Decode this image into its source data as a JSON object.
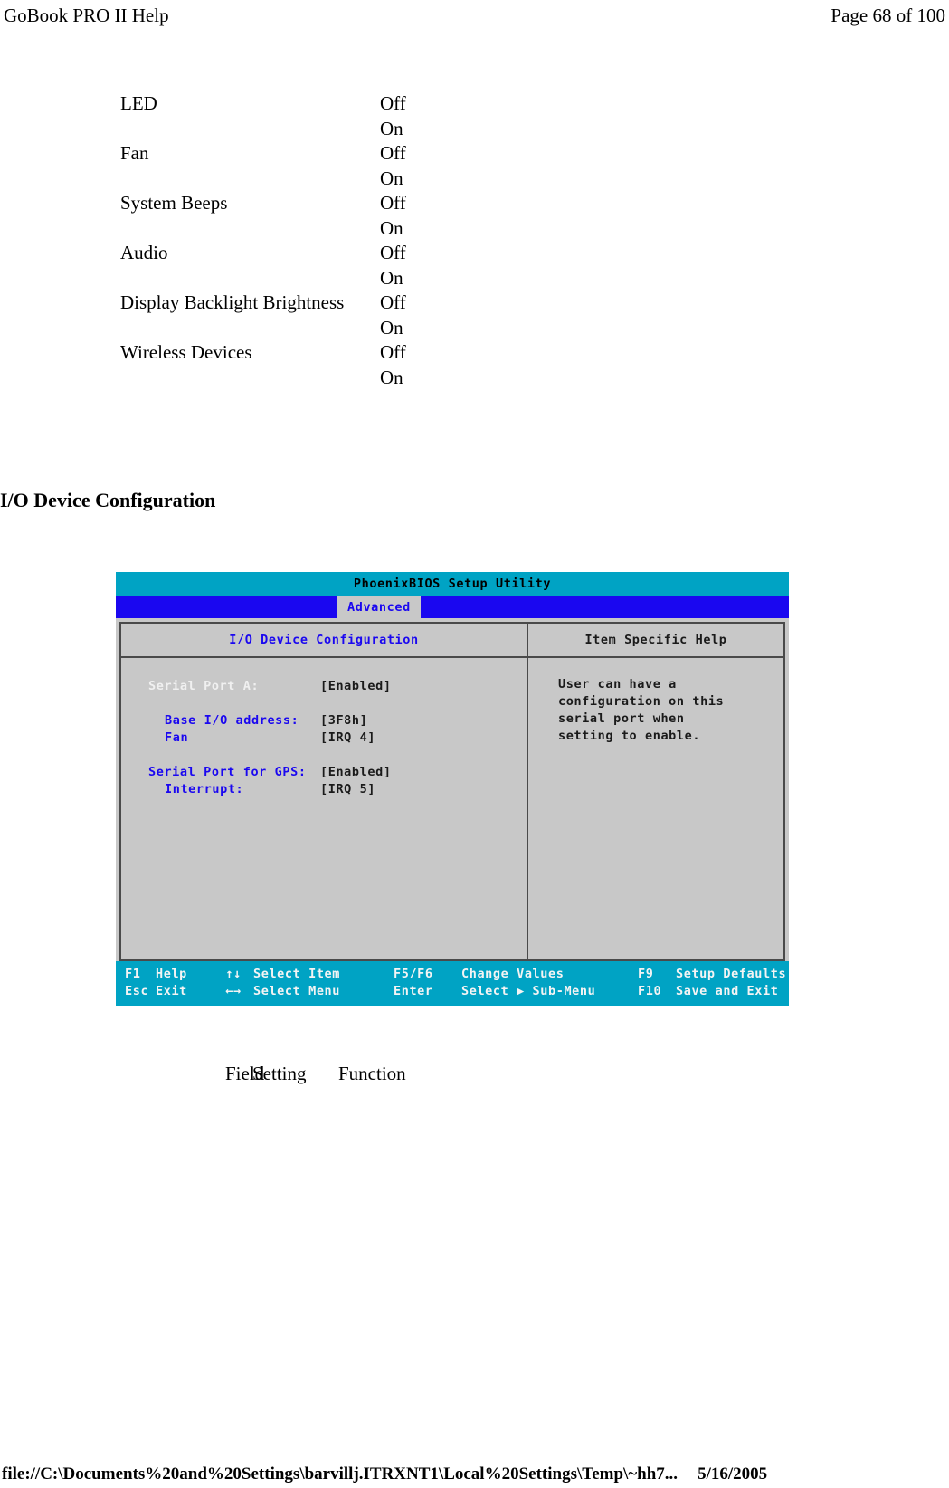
{
  "header": {
    "doc_title": "GoBook PRO II Help",
    "page_indicator": "Page 68 of 100"
  },
  "hotkey_table": {
    "rows": [
      {
        "field": "LED",
        "setting_off": "Off",
        "setting_on": "On"
      },
      {
        "field": "Fan",
        "setting_off": "Off",
        "setting_on": "On"
      },
      {
        "field": "System Beeps",
        "setting_off": "Off",
        "setting_on": "On"
      },
      {
        "field": "Audio",
        "setting_off": "Off",
        "setting_on": "On"
      },
      {
        "field": "Display Backlight Brightness",
        "setting_off": "Off",
        "setting_on": "On"
      },
      {
        "field": "Wireless Devices",
        "setting_off": "Off",
        "setting_on": "On"
      }
    ]
  },
  "section": {
    "heading": "I/O Device Configuration"
  },
  "bios": {
    "title": "PhoenixBIOS Setup Utility",
    "active_tab": "Advanced",
    "left_panel_title": "I/O Device Configuration",
    "right_panel_title": "Item Specific Help",
    "settings": [
      {
        "label": "Serial Port A:",
        "value": "[Enabled]",
        "state": "selected",
        "indent": false
      },
      {
        "label": "",
        "value": "",
        "state": "spacer",
        "indent": false
      },
      {
        "label": "Base I/O address:",
        "value": "[3F8h]",
        "state": "normal",
        "indent": true
      },
      {
        "label": "Fan",
        "value": "[IRQ 4]",
        "state": "normal",
        "indent": true
      },
      {
        "label": "",
        "value": "",
        "state": "spacer",
        "indent": false
      },
      {
        "label": "Serial Port for GPS:",
        "value": "[Enabled]",
        "state": "normal",
        "indent": false
      },
      {
        "label": "Interrupt:",
        "value": "[IRQ 5]",
        "state": "normal",
        "indent": true
      }
    ],
    "help_lines": [
      "User can have a",
      "configuration on this",
      "serial port when",
      "setting to enable."
    ],
    "footer": {
      "row1": {
        "key1": "F1",
        "action1": "Help",
        "key2": "↑↓",
        "action2": "Select Item",
        "key3": "F5/F6",
        "action3": "Change Values",
        "key4": "F9",
        "action4": "Setup Defaults"
      },
      "row2": {
        "key1": "Esc",
        "action1": "Exit",
        "key2": "←→",
        "action2": "Select Menu",
        "key3": "Enter",
        "action3": "Select ▶ Sub-Menu",
        "key4": "F10",
        "action4": "Save and Exit"
      }
    },
    "colors": {
      "title_bar": "#00a3c4",
      "menu_bar": "#1a07f0",
      "panel_bg": "#c8c8c8",
      "label_blue": "#1a07f0",
      "footer_bar": "#00a3c4"
    }
  },
  "caption": {
    "col_field": "Field",
    "col_setting": "Setting",
    "col_function": "Function"
  },
  "footer": {
    "url": "file://C:\\Documents%20and%20Settings\\barvillj.ITRXNT1\\Local%20Settings\\Temp\\~hh7...",
    "date": "5/16/2005"
  }
}
